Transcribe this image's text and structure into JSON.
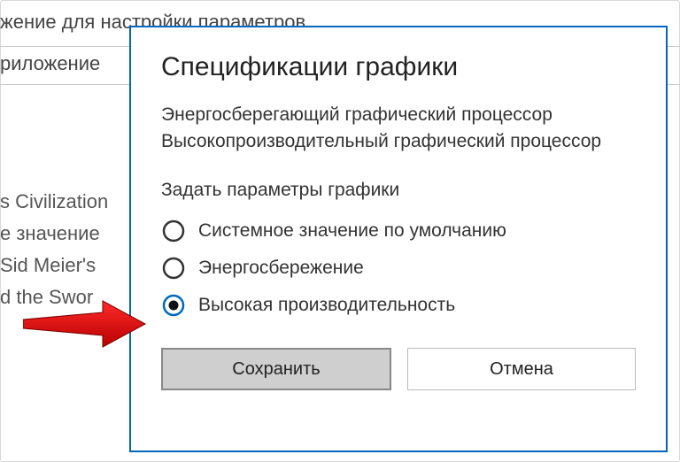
{
  "bg": {
    "line1": "жение для настройки параметров",
    "line2": "риложение",
    "list": [
      "s Civilization",
      "е значение",
      "Sid Meier's",
      "d the Swor"
    ]
  },
  "dialog": {
    "title": "Спецификации графики",
    "desc_line1": "Энергосберегающий графический процессор",
    "desc_line2": "Высокопроизводительный графический процессор",
    "subhead": "Задать параметры графики",
    "options": {
      "opt0": "Системное значение по умолчанию",
      "opt1": "Энергосбережение",
      "opt2": "Высокая производительность"
    },
    "selected_index": 2,
    "buttons": {
      "save": "Сохранить",
      "cancel": "Отмена"
    }
  },
  "colors": {
    "accent": "#0067c0",
    "arrow": "#e60000"
  }
}
